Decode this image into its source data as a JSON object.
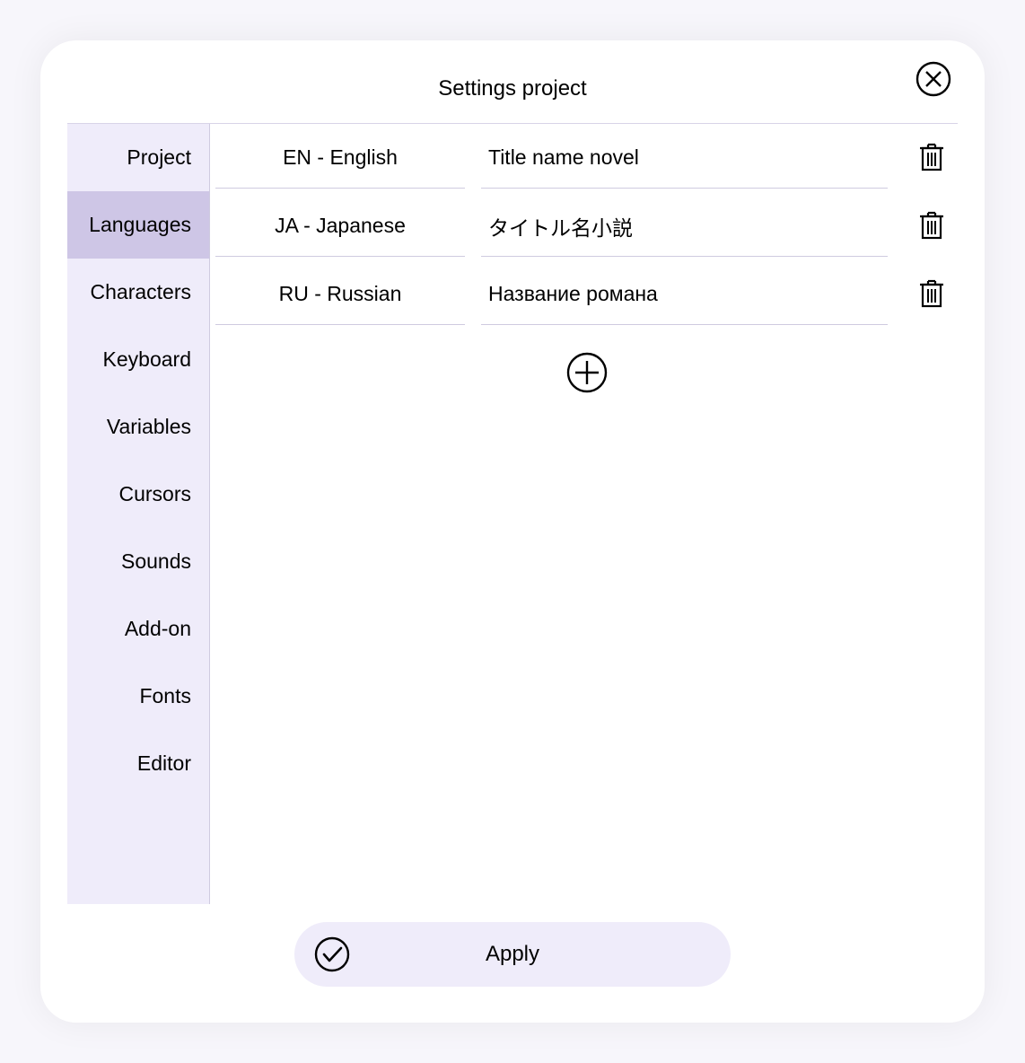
{
  "header": {
    "title": "Settings project"
  },
  "sidebar": {
    "active_index": 1,
    "items": [
      {
        "label": "Project"
      },
      {
        "label": "Languages"
      },
      {
        "label": "Characters"
      },
      {
        "label": "Keyboard"
      },
      {
        "label": "Variables"
      },
      {
        "label": "Cursors"
      },
      {
        "label": "Sounds"
      },
      {
        "label": "Add-on"
      },
      {
        "label": "Fonts"
      },
      {
        "label": "Editor"
      }
    ]
  },
  "languages": [
    {
      "code": "EN - English",
      "title": "Title name novel"
    },
    {
      "code": "JA - Japanese",
      "title": "タイトル名小説"
    },
    {
      "code": "RU - Russian",
      "title": "Название романа"
    }
  ],
  "footer": {
    "apply_label": "Apply"
  }
}
